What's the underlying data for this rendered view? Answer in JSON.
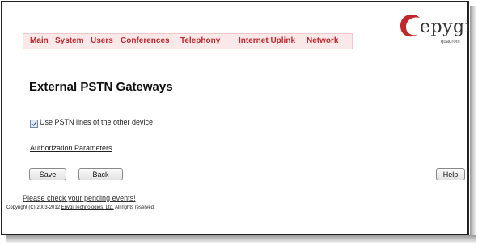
{
  "menu": {
    "items": [
      {
        "label": "Main"
      },
      {
        "label": "System"
      },
      {
        "label": "Users"
      },
      {
        "label": "Conferences"
      },
      {
        "label": "Telephony"
      },
      {
        "label": "Internet Uplink"
      },
      {
        "label": "Network"
      }
    ]
  },
  "logo": {
    "brand": "epygi",
    "product": "quadrom"
  },
  "page": {
    "title": "External PSTN Gateways"
  },
  "settings": {
    "use_pstn_label": "Use PSTN lines of the other device",
    "use_pstn_checked": true,
    "auth_link": "Authorization Parameters"
  },
  "buttons": {
    "save": "Save",
    "back": "Back",
    "help": "Help"
  },
  "footer": {
    "pending": "Please check your pending events!",
    "copyright_prefix": "Copyright (C) 2003-2012",
    "company": "Epygi Technologies, Ltd.",
    "copyright_suffix": "All rights reserved."
  },
  "colors": {
    "menu_text": "#c0272d",
    "menu_bg": "#fbe9e9",
    "logo_red": "#c0272d"
  }
}
